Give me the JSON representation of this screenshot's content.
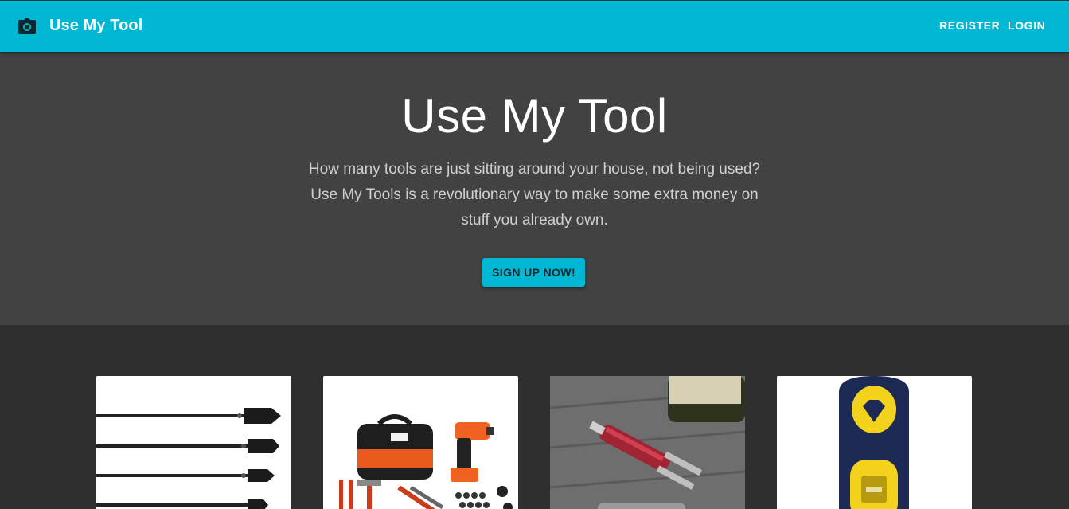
{
  "appbar": {
    "title": "Use My Tool",
    "icon": "camera-icon",
    "register_label": "REGISTER",
    "login_label": "LOGIN"
  },
  "hero": {
    "title": "Use My Tool",
    "description": "How many tools are just sitting around your house, not being used? Use My Tools is a revolutionary way to make some extra money on stuff you already own.",
    "cta_label": "SIGN UP NOW!"
  },
  "tools": [
    {
      "image": "spade-drill-bits-image"
    },
    {
      "image": "drill-tool-kit-image"
    },
    {
      "image": "multitool-image"
    },
    {
      "image": "stud-finder-image"
    }
  ],
  "colors": {
    "primary": "#00b8d4",
    "hero_bg": "#424242",
    "page_bg": "#2f2f2f"
  }
}
